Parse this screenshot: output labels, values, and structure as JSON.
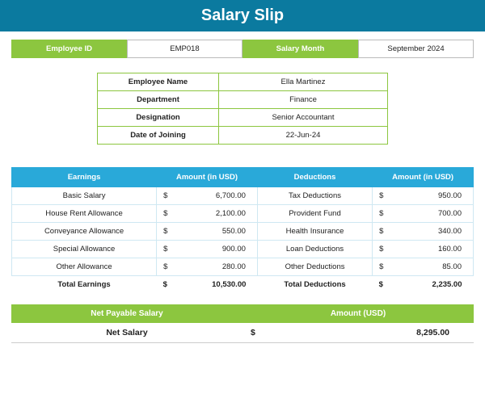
{
  "title": "Salary Slip",
  "top": {
    "employeeIdLabel": "Employee ID",
    "employeeId": "EMP018",
    "salaryMonthLabel": "Salary Month",
    "salaryMonth": "September 2024"
  },
  "info": {
    "nameLabel": "Employee Name",
    "name": "Ella Martinez",
    "deptLabel": "Department",
    "dept": "Finance",
    "desigLabel": "Designation",
    "desig": "Senior Accountant",
    "dojLabel": "Date of Joining",
    "doj": "22-Jun-24"
  },
  "headers": {
    "earnings": "Earnings",
    "earnAmt": "Amount (in USD)",
    "deductions": "Deductions",
    "dedAmt": "Amount (in USD)"
  },
  "currency": "$",
  "rows": [
    {
      "eLabel": "Basic Salary",
      "eAmt": "6,700.00",
      "dLabel": "Tax Deductions",
      "dAmt": "950.00"
    },
    {
      "eLabel": "House Rent Allowance",
      "eAmt": "2,100.00",
      "dLabel": "Provident Fund",
      "dAmt": "700.00"
    },
    {
      "eLabel": "Conveyance Allowance",
      "eAmt": "550.00",
      "dLabel": "Health Insurance",
      "dAmt": "340.00"
    },
    {
      "eLabel": "Special Allowance",
      "eAmt": "900.00",
      "dLabel": "Loan Deductions",
      "dAmt": "160.00"
    },
    {
      "eLabel": "Other Allowance",
      "eAmt": "280.00",
      "dLabel": "Other Deductions",
      "dAmt": "85.00"
    }
  ],
  "totals": {
    "eLabel": "Total Earnings",
    "eAmt": "10,530.00",
    "dLabel": "Total Deductions",
    "dAmt": "2,235.00"
  },
  "net": {
    "headerLabel": "Net Payable Salary",
    "headerAmt": "Amount (USD)",
    "label": "Net Salary",
    "amt": "8,295.00"
  }
}
